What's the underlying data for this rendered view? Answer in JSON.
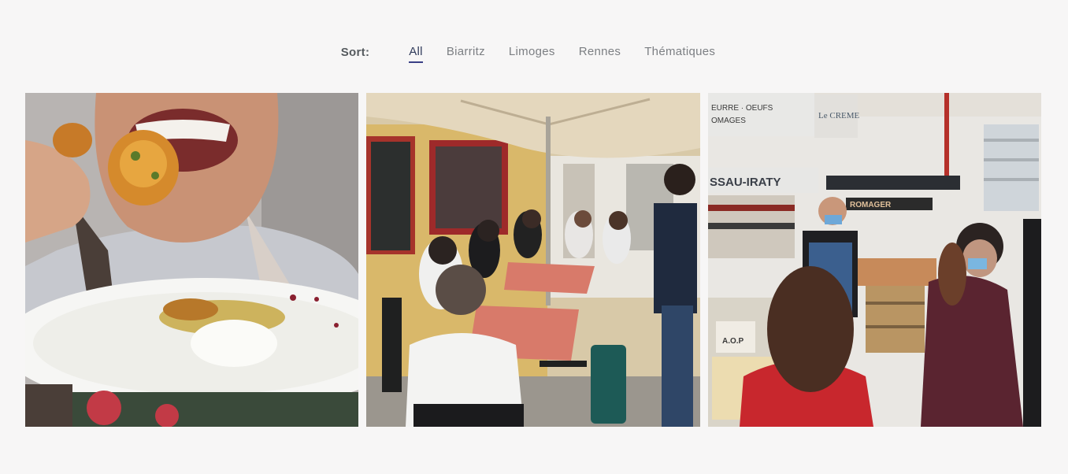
{
  "filters": {
    "sort_label": "Sort:",
    "items": [
      {
        "label": "All",
        "active": true
      },
      {
        "label": "Biarritz",
        "active": false
      },
      {
        "label": "Limoges",
        "active": false
      },
      {
        "label": "Rennes",
        "active": false
      },
      {
        "label": "Thématiques",
        "active": false
      }
    ]
  },
  "gallery": {
    "photos": [
      {
        "subject": "person-eating-fritter-with-plate"
      },
      {
        "subject": "group-at-cafe-terrace"
      },
      {
        "subject": "group-at-cheese-shop-counter",
        "signs": [
          "SSAU-IRATY",
          "ROMAGER",
          "A.O.P",
          "EURRE · OEUFS",
          "OMAGES",
          "Le CREME"
        ]
      }
    ]
  }
}
